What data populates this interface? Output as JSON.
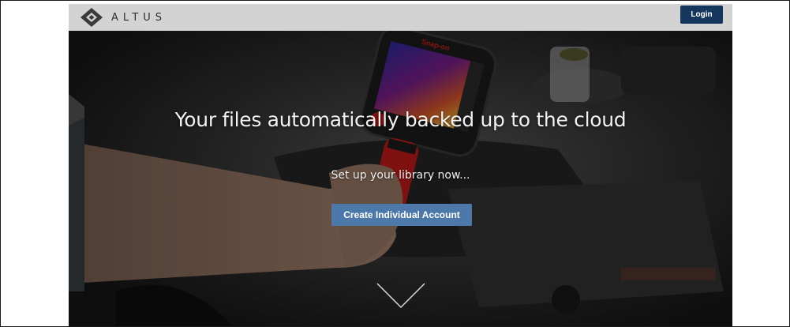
{
  "header": {
    "logo_text": "ALTUS",
    "logo_icon": "altus-diamond-logo",
    "login_label": "Login",
    "login_color": "#15375e"
  },
  "hero": {
    "title": "Your files automatically backed up to the cloud",
    "subtitle": "Set up your library now...",
    "cta_label": "Create Individual Account",
    "cta_color": "#4c79a9",
    "device_brand": "Snap-on",
    "scroll_icon": "chevron-down-icon"
  }
}
